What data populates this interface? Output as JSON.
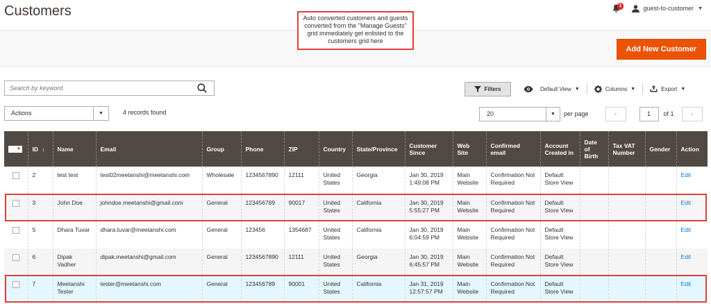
{
  "page": {
    "title": "Customers"
  },
  "header": {
    "notification_count": "1",
    "username": "guest-to-customer"
  },
  "callout": {
    "text": "Auto converted customers and guests converted from the \"Manage Guests\" grid immediately get enlisted to the customers grid here"
  },
  "action_bar": {
    "add_button": "Add New Customer"
  },
  "search": {
    "placeholder": "Search by keyword"
  },
  "toolbar": {
    "filters": "Filters",
    "view": "Default View",
    "columns": "Columns",
    "export": "Export"
  },
  "mass_actions": {
    "label": "Actions",
    "records_found": "4 records found"
  },
  "pager": {
    "per_page_value": "20",
    "per_page_label": "per page",
    "current_page": "1",
    "of_pages": "of 1"
  },
  "columns": {
    "id": "ID",
    "id_sort": "↓",
    "name": "Name",
    "email": "Email",
    "group": "Group",
    "phone": "Phone",
    "zip": "ZIP",
    "country": "Country",
    "state": "State/Province",
    "since": "Customer Since",
    "website": "Web Site",
    "confirmed": "Confirmed email",
    "account_created": "Account Created in",
    "dob": "Date of Birth",
    "tax": "Tax VAT Number",
    "gender": "Gender",
    "action": "Action"
  },
  "rows": [
    {
      "id": "2",
      "name": "test test",
      "email": "test02meetanshi@meetanshi.com",
      "group": "Wholesale",
      "phone": "1234567890",
      "zip": "12111",
      "country": "United States",
      "state": "Georgia",
      "since": "Jan 30, 2019 1:49:08 PM",
      "website": "Main Website",
      "confirmed": "Confirmation Not Required",
      "account_created": "Default Store View",
      "dob": "",
      "tax": "",
      "gender": "",
      "action": "Edit"
    },
    {
      "id": "3",
      "name": "John Doe",
      "email": "johndoe.meetanshi@gmail.com",
      "group": "General",
      "phone": "123456789",
      "zip": "90017",
      "country": "United States",
      "state": "California",
      "since": "Jan 30, 2019 5:55:27 PM",
      "website": "Main Website",
      "confirmed": "Confirmation Not Required",
      "account_created": "Default Store View",
      "dob": "",
      "tax": "",
      "gender": "",
      "action": "Edit"
    },
    {
      "id": "5",
      "name": "Dhara Tuvar",
      "email": "dhara.tuvar@meetanshi.com",
      "group": "General",
      "phone": "123456",
      "zip": "1354687",
      "country": "United States",
      "state": "California",
      "since": "Jan 30, 2019 6:04:59 PM",
      "website": "Main Website",
      "confirmed": "Confirmation Not Required",
      "account_created": "Default Store View",
      "dob": "",
      "tax": "",
      "gender": "",
      "action": "Edit"
    },
    {
      "id": "6",
      "name": "Dipak Vadher",
      "email": "dipak.meetanshi@gmail.com",
      "group": "General",
      "phone": "1234567890",
      "zip": "12111",
      "country": "United States",
      "state": "Georgia",
      "since": "Jan 30, 2019 6:45:57 PM",
      "website": "Main Website",
      "confirmed": "Confirmation Not Required",
      "account_created": "Default Store View",
      "dob": "",
      "tax": "",
      "gender": "",
      "action": "Edit"
    },
    {
      "id": "7",
      "name": "Meetanshi Tester",
      "email": "tester@meetanshi.com",
      "group": "General",
      "phone": "123456789",
      "zip": "90001",
      "country": "United States",
      "state": "California",
      "since": "Jan 31, 2019 12:57:57 PM",
      "website": "Main Website",
      "confirmed": "Confirmation Not Required",
      "account_created": "Default Store View",
      "dob": "",
      "tax": "",
      "gender": "",
      "action": "Edit"
    }
  ]
}
